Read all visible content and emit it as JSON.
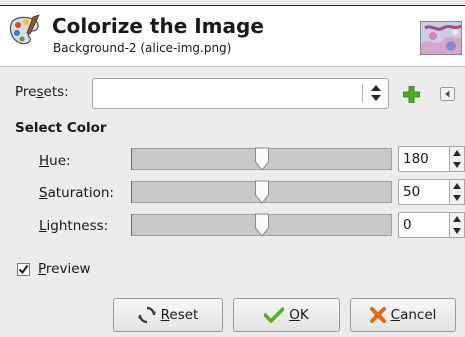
{
  "header": {
    "icon": "colorize-tool-icon",
    "title": "Colorize the Image",
    "subtitle": "Background-2 (alice-img.png)",
    "thumbnail": "layer-thumbnail"
  },
  "presets": {
    "label_pre": "Pre",
    "label_mnemonic": "s",
    "label_post": "ets:",
    "value": "",
    "add_icon": "plus-icon",
    "menu_icon": "triangle-left-icon"
  },
  "select_color": {
    "title": "Select Color",
    "sliders": [
      {
        "mnemonic": "H",
        "rest": "ue:",
        "value": "180",
        "fraction": 0.5
      },
      {
        "mnemonic": "S",
        "rest": "aturation:",
        "value": "50",
        "fraction": 0.5
      },
      {
        "mnemonic": "L",
        "rest": "ightness:",
        "value": "0",
        "fraction": 0.5
      }
    ]
  },
  "preview": {
    "checked": true,
    "mnemonic": "P",
    "rest": "review"
  },
  "buttons": {
    "reset": {
      "mnemonic": "R",
      "rest": "eset",
      "icon": "reset-icon"
    },
    "ok": {
      "mnemonic": "O",
      "rest": "K",
      "icon": "checkmark-icon"
    },
    "cancel": {
      "mnemonic": "C",
      "rest": "ancel",
      "icon": "cancel-x-icon"
    }
  },
  "colors": {
    "ok_icon": "#58b020",
    "cancel_icon": "#e06a10",
    "plus_icon": "#4caa28"
  }
}
